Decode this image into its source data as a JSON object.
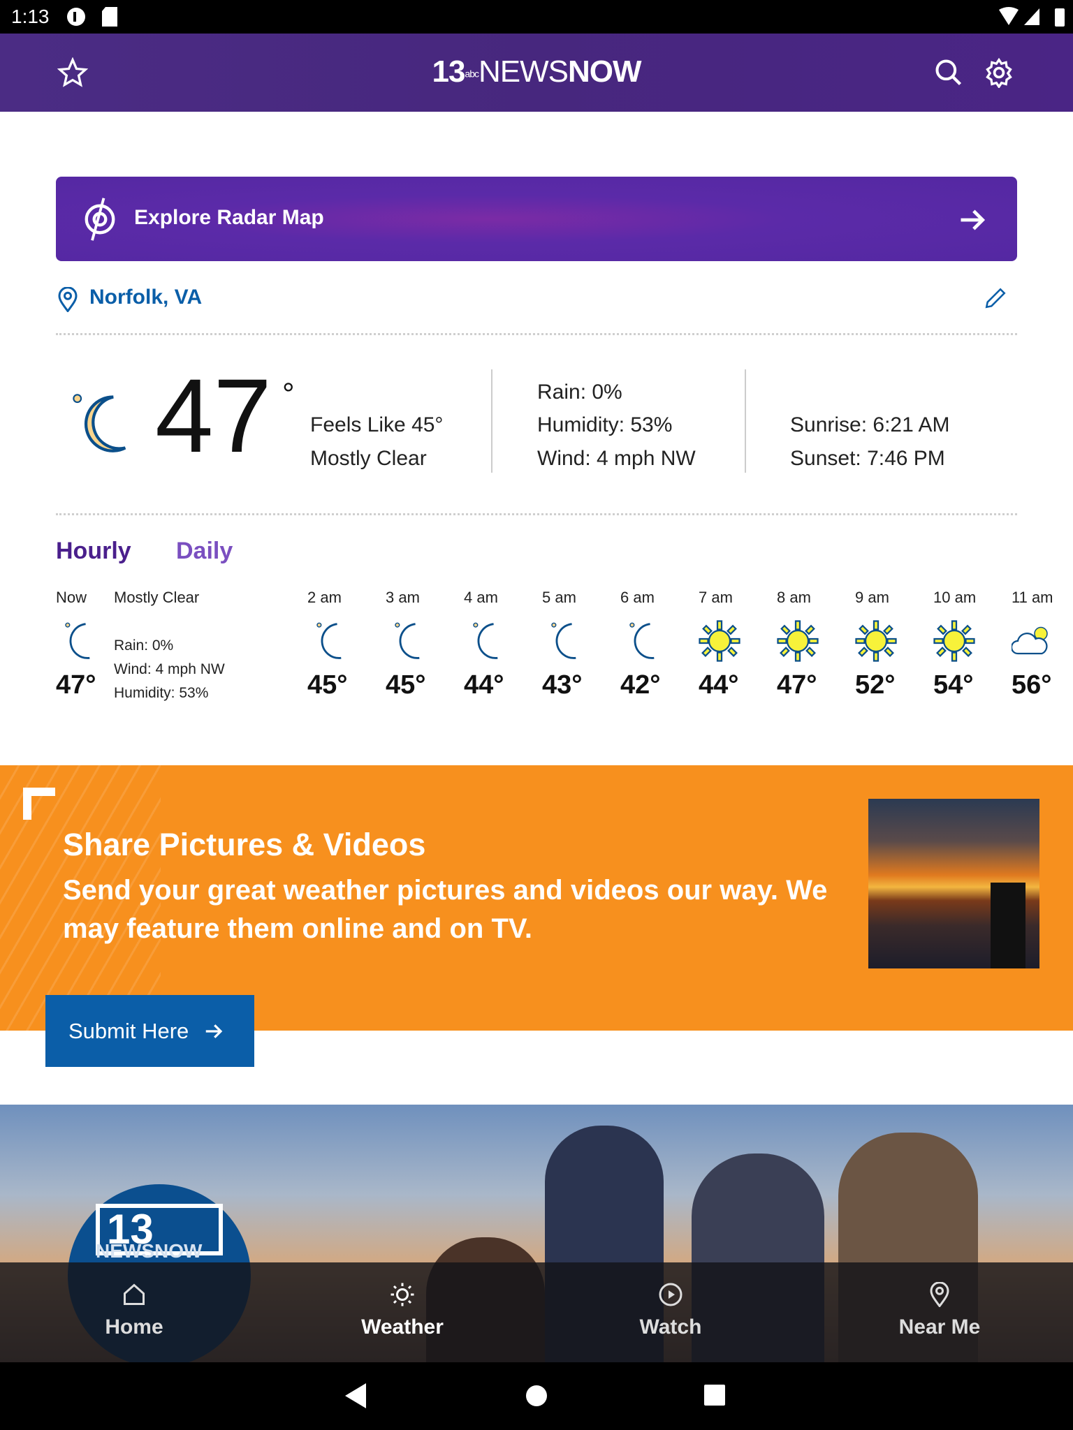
{
  "status_bar": {
    "time": "1:13"
  },
  "header": {
    "logo_num": "13",
    "logo_news": "NEWS",
    "logo_now": "NOW",
    "logo_abc": "abc"
  },
  "radar": {
    "label": "Explore Radar Map"
  },
  "location": {
    "name": "Norfolk, VA"
  },
  "current": {
    "temp": "47",
    "degree": "°",
    "feels_like": "Feels Like 45°",
    "condition": "Mostly Clear",
    "rain": "Rain: 0%",
    "humidity": "Humidity: 53%",
    "wind": "Wind: 4 mph NW",
    "sunrise": "Sunrise: 6:21 AM",
    "sunset": "Sunset: 7:46 PM"
  },
  "forecast_tabs": {
    "hourly": "Hourly",
    "daily": "Daily",
    "active": "Hourly"
  },
  "now": {
    "label": "Now",
    "condition": "Mostly Clear",
    "temp": "47°",
    "rain": "Rain: 0%",
    "wind": "Wind: 4 mph NW",
    "humidity": "Humidity: 53%",
    "icon": "moon"
  },
  "hourly": [
    {
      "time": "2 am",
      "temp": "45°",
      "icon": "moon"
    },
    {
      "time": "3 am",
      "temp": "45°",
      "icon": "moon"
    },
    {
      "time": "4 am",
      "temp": "44°",
      "icon": "moon"
    },
    {
      "time": "5 am",
      "temp": "43°",
      "icon": "moon"
    },
    {
      "time": "6 am",
      "temp": "42°",
      "icon": "moon"
    },
    {
      "time": "7 am",
      "temp": "44°",
      "icon": "sun"
    },
    {
      "time": "8 am",
      "temp": "47°",
      "icon": "sun"
    },
    {
      "time": "9 am",
      "temp": "52°",
      "icon": "sun"
    },
    {
      "time": "10 am",
      "temp": "54°",
      "icon": "sun"
    },
    {
      "time": "11 am",
      "temp": "56°",
      "icon": "partly-cloudy"
    }
  ],
  "share": {
    "title": "Share Pictures & Videos",
    "subtitle": "Send your great weather pictures and videos our way. We may feature them online and on TV.",
    "button": "Submit Here"
  },
  "promo": {
    "logo_num": "13",
    "logo_text": "NEWSNOW"
  },
  "bottom_nav": [
    {
      "label": "Home",
      "icon": "home"
    },
    {
      "label": "Weather",
      "icon": "sun",
      "active": true
    },
    {
      "label": "Watch",
      "icon": "play"
    },
    {
      "label": "Near Me",
      "icon": "pin"
    }
  ],
  "colors": {
    "header": "#4b2c84",
    "accent_blue": "#0a5ea8",
    "orange": "#f7901e",
    "tab_active": "#4a1f8c",
    "tab_inactive": "#7a4fc0"
  }
}
